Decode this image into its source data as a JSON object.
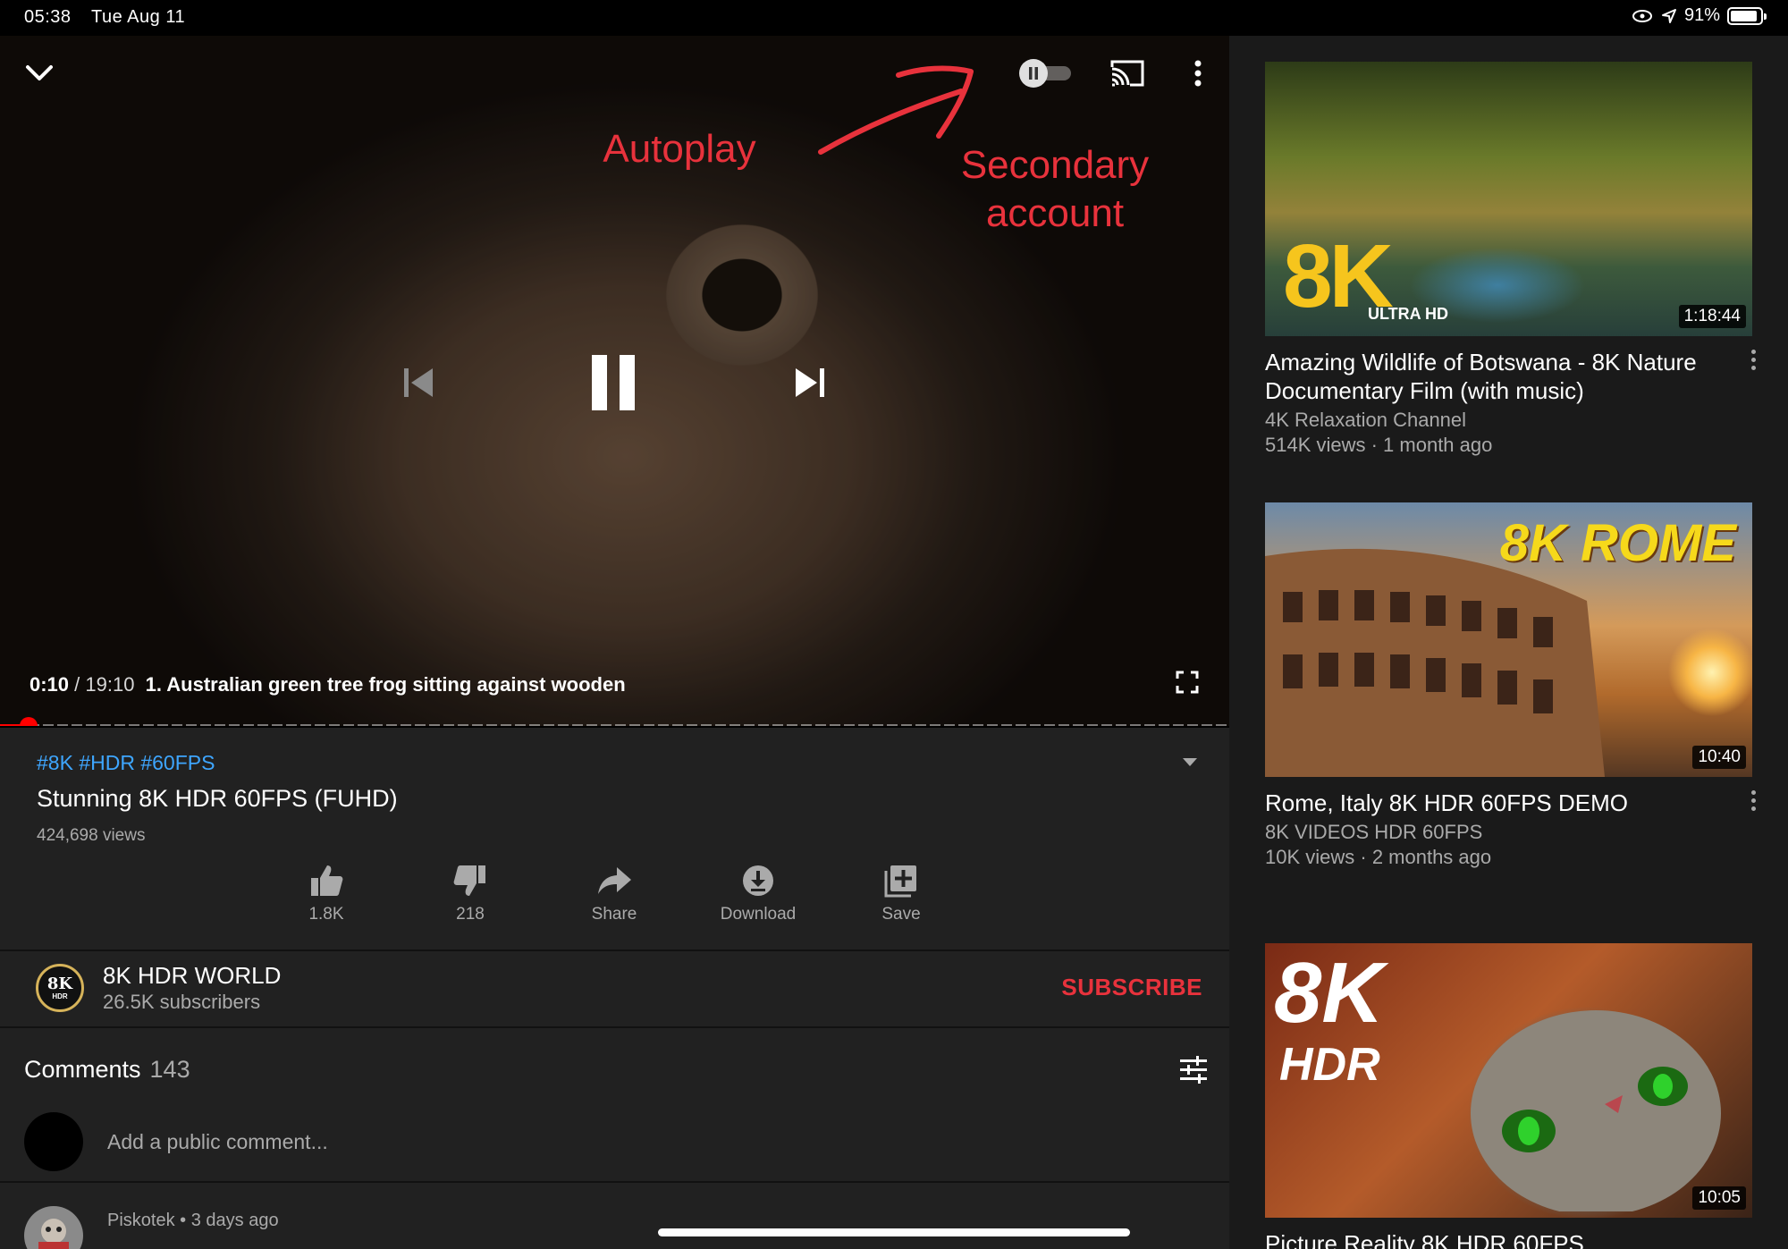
{
  "status_bar": {
    "time": "05:38",
    "date": "Tue Aug 11",
    "battery": "91%"
  },
  "player": {
    "annotations": {
      "autoplay": "Autoplay",
      "secondary_account": "Secondary account"
    },
    "current_time": "0:10",
    "separator": "/",
    "duration": "19:10",
    "chapter": "1. Australian green tree frog sitting against wooden",
    "progress_fraction": 0.009,
    "icons": [
      "chevron-down-icon",
      "autoplay-toggle-icon",
      "cast-icon",
      "more-vert-icon",
      "previous-icon",
      "pause-icon",
      "next-icon",
      "fullscreen-icon"
    ]
  },
  "video": {
    "hashtags": "#8K #HDR #60FPS",
    "title": "Stunning 8K HDR 60FPS (FUHD)",
    "views": "424,698 views",
    "actions": {
      "like": "1.8K",
      "dislike": "218",
      "share": "Share",
      "download": "Download",
      "save": "Save"
    }
  },
  "channel": {
    "logo_text": "8K",
    "logo_sub": "HDR",
    "name": "8K HDR WORLD",
    "subscribers": "26.5K subscribers",
    "subscribe_label": "SUBSCRIBE"
  },
  "comments": {
    "label": "Comments",
    "count": "143",
    "placeholder": "Add a public comment...",
    "first": {
      "author": "Piskotek",
      "time": "3 days ago"
    }
  },
  "recommendations": [
    {
      "title": "Amazing Wildlife of Botswana - 8K Nature Documentary Film (with music)",
      "channel": "4K Relaxation Channel",
      "meta": "514K views · 1 month ago",
      "duration": "1:18:44",
      "thumb_text": "8K",
      "thumb_subtext": "ULTRA HD"
    },
    {
      "title": "Rome, Italy 8K HDR 60FPS DEMO",
      "channel": "8K VIDEOS HDR 60FPS",
      "meta": "10K views · 2 months ago",
      "duration": "10:40",
      "thumb_text": "8K ROME"
    },
    {
      "title": "Picture Reality 8K HDR 60FPS",
      "duration": "10:05",
      "thumb_text": "8K",
      "thumb_subtext": "HDR"
    }
  ],
  "colors": {
    "accent_red": "#e8323c",
    "link_blue": "#3ea6ff",
    "progress_red": "#ff0000"
  }
}
